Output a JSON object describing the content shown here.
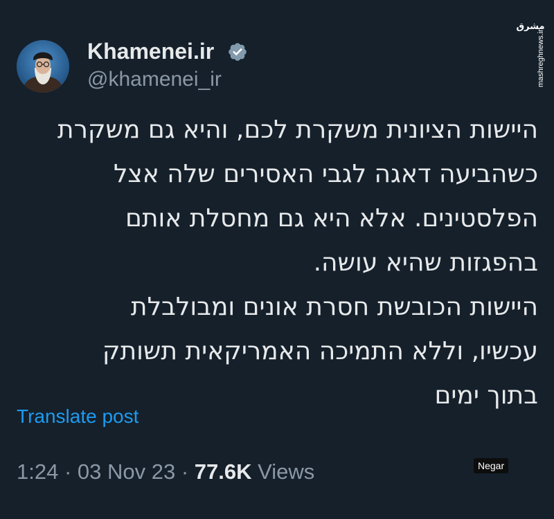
{
  "author": {
    "display_name": "Khamenei.ir",
    "handle": "@khamenei_ir",
    "verified": true
  },
  "tweet": {
    "lines": [
      "היישות הציונית משקרת לכם, והיא גם משקרת",
      "כשהביעה דאגה לגבי האסירים שלה אצל",
      "הפלסטינים. אלא היא גם מחסלת אותם",
      "בהפגזות שהיא עושה.",
      "היישות הכובשת חסרת אונים ומבולבלת",
      "עכשיו, וללא התמיכה האמריקאית תשותק",
      "בתוך ימים"
    ]
  },
  "translate": {
    "label": "Translate post"
  },
  "meta": {
    "time": "1:24",
    "separator": " · ",
    "date": "03 Nov 23",
    "views_count": "77.6K",
    "views_label": " Views"
  },
  "watermarks": {
    "site": "mashreghnews.ir",
    "site_logo_text": "مشرق",
    "negar": "Negar"
  },
  "colors": {
    "background": "#15202b",
    "text": "#e7e9ea",
    "muted": "#8b98a5",
    "link": "#1d9bf0",
    "verified": "#829aab"
  },
  "icons": {
    "verified": "verified-badge-icon",
    "avatar": "profile-avatar-image"
  }
}
